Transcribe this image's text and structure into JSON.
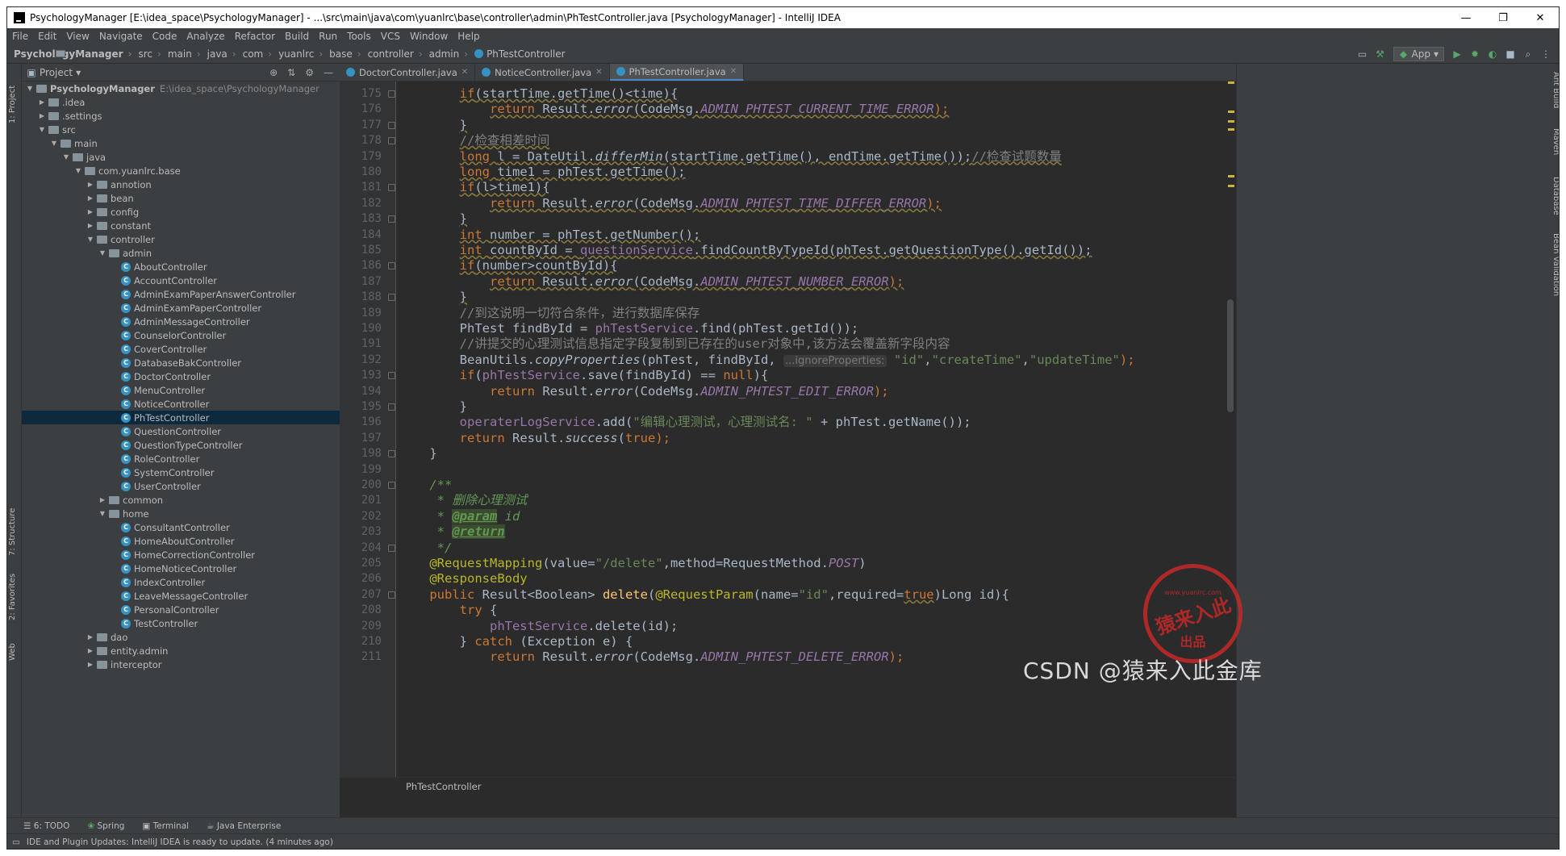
{
  "window": {
    "title": "PsychologyManager [E:\\idea_space\\PsychologyManager] - ...\\src\\main\\java\\com\\yuanlrc\\base\\controller\\admin\\PhTestController.java [PsychologyManager] - IntelliJ IDEA",
    "buttons": {
      "min": "—",
      "max": "❐",
      "close": "✕"
    }
  },
  "menu": [
    "File",
    "Edit",
    "View",
    "Navigate",
    "Code",
    "Analyze",
    "Refactor",
    "Build",
    "Run",
    "Tools",
    "VCS",
    "Window",
    "Help"
  ],
  "breadcrumb": [
    "PsychologyManager",
    "src",
    "main",
    "java",
    "com",
    "yuanlrc",
    "base",
    "controller",
    "admin",
    "PhTestController"
  ],
  "run_config": "App",
  "project": {
    "label": "Project",
    "root_name": "PsychologyManager",
    "root_path": "E:\\idea_space\\PsychologyManager",
    "nodes": [
      {
        "label": ".idea",
        "depth": 1,
        "kind": "folder",
        "state": "closed"
      },
      {
        "label": ".settings",
        "depth": 1,
        "kind": "folder",
        "state": "closed"
      },
      {
        "label": "src",
        "depth": 1,
        "kind": "folder",
        "state": "open"
      },
      {
        "label": "main",
        "depth": 2,
        "kind": "folder",
        "state": "open"
      },
      {
        "label": "java",
        "depth": 3,
        "kind": "folder",
        "state": "open"
      },
      {
        "label": "com.yuanlrc.base",
        "depth": 4,
        "kind": "folder",
        "state": "open"
      },
      {
        "label": "annotion",
        "depth": 5,
        "kind": "folder",
        "state": "closed"
      },
      {
        "label": "bean",
        "depth": 5,
        "kind": "folder",
        "state": "closed"
      },
      {
        "label": "config",
        "depth": 5,
        "kind": "folder",
        "state": "closed"
      },
      {
        "label": "constant",
        "depth": 5,
        "kind": "folder",
        "state": "closed"
      },
      {
        "label": "controller",
        "depth": 5,
        "kind": "folder",
        "state": "open"
      },
      {
        "label": "admin",
        "depth": 6,
        "kind": "folder",
        "state": "open"
      },
      {
        "label": "AboutController",
        "depth": 7,
        "kind": "class"
      },
      {
        "label": "AccountController",
        "depth": 7,
        "kind": "class"
      },
      {
        "label": "AdminExamPaperAnswerController",
        "depth": 7,
        "kind": "class"
      },
      {
        "label": "AdminExamPaperController",
        "depth": 7,
        "kind": "class"
      },
      {
        "label": "AdminMessageController",
        "depth": 7,
        "kind": "class"
      },
      {
        "label": "CounselorController",
        "depth": 7,
        "kind": "class"
      },
      {
        "label": "CoverController",
        "depth": 7,
        "kind": "class"
      },
      {
        "label": "DatabaseBakController",
        "depth": 7,
        "kind": "class"
      },
      {
        "label": "DoctorController",
        "depth": 7,
        "kind": "class"
      },
      {
        "label": "MenuController",
        "depth": 7,
        "kind": "class"
      },
      {
        "label": "NoticeController",
        "depth": 7,
        "kind": "class"
      },
      {
        "label": "PhTestController",
        "depth": 7,
        "kind": "class",
        "selected": true
      },
      {
        "label": "QuestionController",
        "depth": 7,
        "kind": "class"
      },
      {
        "label": "QuestionTypeController",
        "depth": 7,
        "kind": "class"
      },
      {
        "label": "RoleController",
        "depth": 7,
        "kind": "class"
      },
      {
        "label": "SystemController",
        "depth": 7,
        "kind": "class"
      },
      {
        "label": "UserController",
        "depth": 7,
        "kind": "class"
      },
      {
        "label": "common",
        "depth": 6,
        "kind": "folder",
        "state": "closed"
      },
      {
        "label": "home",
        "depth": 6,
        "kind": "folder",
        "state": "open"
      },
      {
        "label": "ConsultantController",
        "depth": 7,
        "kind": "class"
      },
      {
        "label": "HomeAboutController",
        "depth": 7,
        "kind": "class"
      },
      {
        "label": "HomeCorrectionController",
        "depth": 7,
        "kind": "class"
      },
      {
        "label": "HomeNoticeController",
        "depth": 7,
        "kind": "class"
      },
      {
        "label": "IndexController",
        "depth": 7,
        "kind": "class"
      },
      {
        "label": "LeaveMessageController",
        "depth": 7,
        "kind": "class"
      },
      {
        "label": "PersonalController",
        "depth": 7,
        "kind": "class"
      },
      {
        "label": "TestController",
        "depth": 7,
        "kind": "class"
      },
      {
        "label": "dao",
        "depth": 5,
        "kind": "folder",
        "state": "closed"
      },
      {
        "label": "entity.admin",
        "depth": 5,
        "kind": "folder",
        "state": "closed"
      },
      {
        "label": "interceptor",
        "depth": 5,
        "kind": "folder",
        "state": "closed"
      }
    ]
  },
  "tabs": [
    {
      "label": "DoctorController.java",
      "active": false
    },
    {
      "label": "NoticeController.java",
      "active": false
    },
    {
      "label": "PhTestController.java",
      "active": true
    }
  ],
  "code": {
    "first_line": 175,
    "lines": [
      [
        [
          "        ",
          ""
        ],
        [
          "if",
          "kw wavy"
        ],
        [
          "(startTime.getTime()<time){",
          "wavy"
        ]
      ],
      [
        [
          "            ",
          ""
        ],
        [
          "return ",
          "kw wavy"
        ],
        [
          "Result.",
          "wavy"
        ],
        [
          "error",
          "it wavy"
        ],
        [
          "(CodeMsg.",
          "wavy"
        ],
        [
          "ADMIN_PHTEST_CURRENT_TIME_ERROR",
          "sf wavy"
        ],
        [
          ");",
          "kw wavy"
        ]
      ],
      [
        [
          "        ",
          ""
        ],
        [
          "}",
          "wavy"
        ]
      ],
      [
        [
          "        ",
          ""
        ],
        [
          "//检查相差时间",
          "cm wavy"
        ]
      ],
      [
        [
          "        ",
          ""
        ],
        [
          "long ",
          "kw wavy"
        ],
        [
          "l = DateUtil.",
          "wavy"
        ],
        [
          "differMin",
          "it wavy"
        ],
        [
          "(startTime.getTime(), endTime.getTime());",
          "wavy"
        ],
        [
          "//检查试题数量",
          "cm wavy"
        ]
      ],
      [
        [
          "        ",
          ""
        ],
        [
          "long ",
          "kw wavy"
        ],
        [
          "time1 = phTest.getTime();",
          "wavy"
        ]
      ],
      [
        [
          "        ",
          ""
        ],
        [
          "if",
          "kw wavy"
        ],
        [
          "(l>time1){",
          "wavy"
        ]
      ],
      [
        [
          "            ",
          ""
        ],
        [
          "return ",
          "kw wavy"
        ],
        [
          "Result.",
          "wavy"
        ],
        [
          "error",
          "it wavy"
        ],
        [
          "(CodeMsg.",
          "wavy"
        ],
        [
          "ADMIN_PHTEST_TIME_DIFFER_ERROR",
          "sf wavy"
        ],
        [
          ");",
          "kw wavy"
        ]
      ],
      [
        [
          "        ",
          ""
        ],
        [
          "}",
          "wavy"
        ]
      ],
      [
        [
          "        ",
          ""
        ],
        [
          "int ",
          "kw wavy"
        ],
        [
          "number = phTest.getNumber();",
          "wavy"
        ]
      ],
      [
        [
          "        ",
          ""
        ],
        [
          "int ",
          "kw wavy"
        ],
        [
          "countById = ",
          "wavy"
        ],
        [
          "questionService",
          "pref wavy"
        ],
        [
          ".findCountByTypeId(phTest.getQuestionType().getId());",
          "wavy"
        ]
      ],
      [
        [
          "        ",
          ""
        ],
        [
          "if",
          "kw wavy"
        ],
        [
          "(number>countById){",
          "wavy"
        ]
      ],
      [
        [
          "            ",
          ""
        ],
        [
          "return ",
          "kw wavy"
        ],
        [
          "Result.",
          "wavy"
        ],
        [
          "error",
          "it wavy"
        ],
        [
          "(CodeMsg.",
          "wavy"
        ],
        [
          "ADMIN_PHTEST_NUMBER_ERROR",
          "sf wavy"
        ],
        [
          ");",
          "kw wavy"
        ]
      ],
      [
        [
          "        ",
          ""
        ],
        [
          "}",
          "wavy"
        ]
      ],
      [
        [
          "        ",
          ""
        ],
        [
          "//到这说明一切符合条件，进行数据库保存",
          "cm"
        ]
      ],
      [
        [
          "        PhTest findById = ",
          ""
        ],
        [
          "phTestService",
          "pref"
        ],
        [
          ".find(phTest.getId());",
          ""
        ]
      ],
      [
        [
          "        ",
          ""
        ],
        [
          "//讲提交的心理测试信息指定字段复制到已存在的user对象中,该方法会覆盖新字段内容",
          "cm"
        ]
      ],
      [
        [
          "        BeanUtils.",
          ""
        ],
        [
          "copyProperties",
          "it"
        ],
        [
          "(phTest, findById, ",
          ""
        ],
        [
          "...ignoreProperties:",
          "hint"
        ],
        [
          " ",
          ""
        ],
        [
          "\"id\"",
          "st"
        ],
        [
          ",",
          ""
        ],
        [
          "\"createTime\"",
          "st"
        ],
        [
          ",",
          ""
        ],
        [
          "\"updateTime\"",
          "st"
        ],
        [
          ");",
          "kw"
        ]
      ],
      [
        [
          "        ",
          ""
        ],
        [
          "if",
          "kw"
        ],
        [
          "(",
          ""
        ],
        [
          "phTestService",
          "pref"
        ],
        [
          ".save(findById) == ",
          ""
        ],
        [
          "null",
          "kw"
        ],
        [
          "){",
          ""
        ]
      ],
      [
        [
          "            ",
          ""
        ],
        [
          "return ",
          "kw"
        ],
        [
          "Result.",
          ""
        ],
        [
          "error",
          "it"
        ],
        [
          "(CodeMsg.",
          ""
        ],
        [
          "ADMIN_PHTEST_EDIT_ERROR",
          "sf"
        ],
        [
          ");",
          "kw"
        ]
      ],
      [
        [
          "        }",
          ""
        ]
      ],
      [
        [
          "        ",
          ""
        ],
        [
          "operaterLogService",
          "pref"
        ],
        [
          ".add(",
          ""
        ],
        [
          "\"编辑心理测试，心理测试名: \"",
          "st"
        ],
        [
          " + phTest.getName());",
          ""
        ]
      ],
      [
        [
          "        ",
          ""
        ],
        [
          "return ",
          "kw"
        ],
        [
          "Result.",
          ""
        ],
        [
          "success",
          "it"
        ],
        [
          "(",
          ""
        ],
        [
          "true",
          "kw"
        ],
        [
          ");",
          "kw"
        ]
      ],
      [
        [
          "    }",
          ""
        ]
      ],
      [
        [
          "",
          ""
        ]
      ],
      [
        [
          "    ",
          ""
        ],
        [
          "/**",
          "dc"
        ]
      ],
      [
        [
          "     ",
          ""
        ],
        [
          "* 删除心理测试",
          "dc"
        ]
      ],
      [
        [
          "     ",
          ""
        ],
        [
          "* ",
          "dc"
        ],
        [
          "@param",
          "dtag"
        ],
        [
          " ",
          ""
        ],
        [
          "id",
          "dc"
        ]
      ],
      [
        [
          "     ",
          ""
        ],
        [
          "* ",
          "dc"
        ],
        [
          "@return",
          "dtag"
        ]
      ],
      [
        [
          "     ",
          ""
        ],
        [
          "*/",
          "dc"
        ]
      ],
      [
        [
          "    ",
          ""
        ],
        [
          "@RequestMapping",
          "an"
        ],
        [
          "(value=",
          ""
        ],
        [
          "\"/delete\"",
          "st"
        ],
        [
          ",method=RequestMethod.",
          ""
        ],
        [
          "POST",
          "sf"
        ],
        [
          ")",
          ""
        ]
      ],
      [
        [
          "    ",
          ""
        ],
        [
          "@ResponseBody",
          "an"
        ]
      ],
      [
        [
          "    ",
          ""
        ],
        [
          "public ",
          "kw"
        ],
        [
          "Result<Boolean> ",
          ""
        ],
        [
          "delete",
          "fn"
        ],
        [
          "(",
          ""
        ],
        [
          "@RequestParam",
          "an"
        ],
        [
          "(name=",
          ""
        ],
        [
          "\"id\"",
          "st"
        ],
        [
          ",required=",
          ""
        ],
        [
          "true",
          "kw wavy"
        ],
        [
          ")Long id){",
          ""
        ]
      ],
      [
        [
          "        ",
          ""
        ],
        [
          "try ",
          "kw"
        ],
        [
          "{",
          ""
        ]
      ],
      [
        [
          "            ",
          ""
        ],
        [
          "phTestService",
          "pref"
        ],
        [
          ".delete(id);",
          ""
        ]
      ],
      [
        [
          "        } ",
          ""
        ],
        [
          "catch ",
          "kw"
        ],
        [
          "(Exception e) {",
          ""
        ]
      ],
      [
        [
          "            ",
          ""
        ],
        [
          "return ",
          "kw"
        ],
        [
          "Result.",
          ""
        ],
        [
          "error",
          "it"
        ],
        [
          "(CodeMsg.",
          ""
        ],
        [
          "ADMIN_PHTEST_DELETE_ERROR",
          "sf"
        ],
        [
          ");",
          "kw"
        ]
      ]
    ],
    "fold_marks": [
      175,
      177,
      178,
      181,
      183,
      186,
      188,
      193,
      195,
      198,
      200,
      204,
      207
    ]
  },
  "editor_breadcrumb": "PhTestController",
  "left_tool_tabs": [
    "1: Project",
    "7: Structure",
    "2: Favorites",
    "Web"
  ],
  "right_tool_tabs": [
    "Ant Build",
    "Maven",
    "Database",
    "Bean Validation"
  ],
  "bottom_tabs": [
    "6: TODO",
    "Spring",
    "Terminal",
    "Java Enterprise"
  ],
  "status_message": "IDE and Plugin Updates: IntelliJ IDEA is ready to update. (4 minutes ago)",
  "stamp": {
    "line1": "www.yuanlrc.com",
    "line2": "猿来入此",
    "line3": "出品"
  },
  "watermark": "CSDN @猿来入此金库"
}
